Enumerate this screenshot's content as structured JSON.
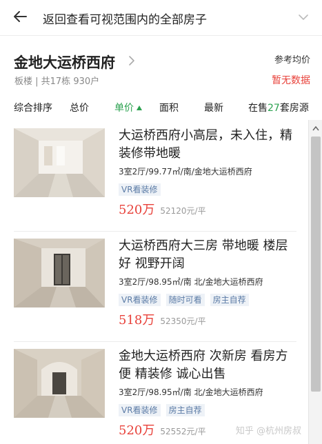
{
  "topbar": {
    "title": "返回查看可视范围内的全部房子"
  },
  "estate": {
    "name": "金地大运桥西府",
    "meta": "板楼 | 共17栋 930户",
    "price_label": "参考均价",
    "price_value": "暂无数据"
  },
  "sort": {
    "composite": "综合排序",
    "total_price": "总价",
    "unit_price": "单价",
    "area": "面积",
    "latest": "最新",
    "on_sale_prefix": "在售",
    "on_sale_count": "27",
    "on_sale_suffix": "套房源"
  },
  "listings": [
    {
      "title": "大运桥西府小高层，未入住，精装修带地暖",
      "spec": "3室2厅/99.77㎡/南/金地大运桥西府",
      "tags": [
        "VR看装修"
      ],
      "total": "520万",
      "unit": "52120元/平"
    },
    {
      "title": "大运桥西府大三房 带地暖 楼层好 视野开阔",
      "spec": "3室2厅/98.95㎡/南 北/金地大运桥西府",
      "tags": [
        "VR看装修",
        "随时可看",
        "房主自荐"
      ],
      "total": "518万",
      "unit": "52350元/平"
    },
    {
      "title": "金地大运桥西府 次新房 看房方便 精装修 诚心出售",
      "spec": "3室2厅/98.95㎡/南 北/金地大运桥西府",
      "tags": [
        "VR看装修",
        "房主自荐"
      ],
      "total": "520万",
      "unit": "52552元/平"
    }
  ],
  "watermark": "知乎 @杭州房叔",
  "colors": {
    "accent_green": "#2ba14f",
    "price_red": "#e8413a",
    "tag_text": "#5b7ba6",
    "tag_bg": "#eef2f7"
  },
  "icons": {
    "back": "arrow-left-icon",
    "collapse": "chevron-down-icon",
    "estate": "chevron-right-icon",
    "sort": "arrow-up-icon"
  }
}
